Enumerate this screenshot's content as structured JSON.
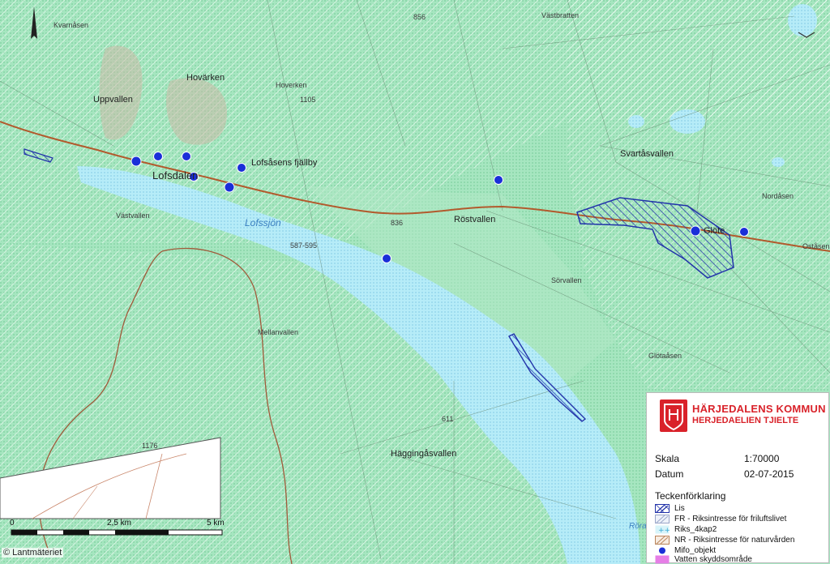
{
  "map": {
    "place_labels": {
      "kvarnasen": "Kvarnåsen",
      "uppvallen": "Uppvallen",
      "hovarken": "Hovärken",
      "lofsdalen": "Lofsdalen",
      "vastvallen": "Västvallen",
      "lofssjon": "Lofssjön",
      "restvallen": "Röstvallen",
      "svartasvallen": "Svartåsvallen",
      "glote": "Glöte",
      "nordasen": "Nordåsen",
      "ostasen": "Oståsen",
      "sorvallen": "Sörvallen",
      "hagginglasvallen": "Häggingåsvallen",
      "hoverken_sm": "Hoverken",
      "lofsasens_fjallby": "Lofsåsens fjällby",
      "vasbratten": "Västbratten",
      "glotasasen": "Glötaåsen",
      "mellanvallen": "Mellanvallen",
      "rora": "Röra"
    },
    "elevation_labels": {
      "e1105": "1105",
      "e836": "836",
      "e611": "611",
      "e1176": "1176",
      "e587": "587-595",
      "e856": "856"
    }
  },
  "legend": {
    "org_name": "HÄRJEDALENS KOMMUN",
    "org_sub": "HERJEDAELIEN TJIELTE",
    "scale_label": "Skala",
    "scale_value": "1:70000",
    "date_label": "Datum",
    "date_value": "02-07-2015",
    "title": "Teckenförklaring",
    "items": [
      {
        "label": "Lis",
        "color": "#2233aa",
        "swatch": "hatch-blue"
      },
      {
        "label": "FR - Riksintresse för friluftslivet",
        "color": "#c0cbe0",
        "swatch": "hatch-gray"
      },
      {
        "label": "Riks_4kap2",
        "color": "#5ed0e8",
        "swatch": "cross-cyan"
      },
      {
        "label": "NR - Riksintresse för naturvården",
        "color": "#b9845a",
        "swatch": "hatch-brown"
      },
      {
        "label": "Mifo_objekt",
        "color": "#1a2fd8",
        "swatch": "dot"
      },
      {
        "label": "Vatten skyddsområde",
        "color": "#e67ee6",
        "swatch": "fill-pink"
      }
    ]
  },
  "scalebar": {
    "ticks": [
      "0",
      "2,5 km",
      "5 km"
    ]
  },
  "copyright": "© Lantmäteriet",
  "colors": {
    "land": "#9ee3b8",
    "water": "#a9e3f5",
    "road": "#b25a2d",
    "mifo": "#1a2fd8",
    "lis": "#2233aa"
  }
}
